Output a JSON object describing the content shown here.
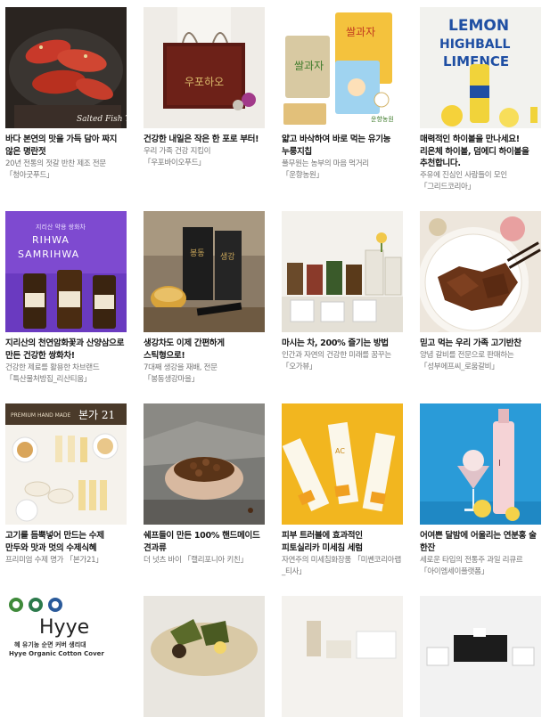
{
  "products": [
    {
      "title": "바다 본연의 맛을 가득 담아 짜지 않은 명란젓",
      "desc": "20년 전통의 젓갈 반찬 제조 전문 「청아굿푸드」",
      "thumb_text": "Salted Fish Types",
      "thumb_icon": "salted-roe-photo-icon"
    },
    {
      "title": "건강한 내일은 작은 한 포로 부터!",
      "desc": "우리 가족 건강 지킴이 「우포바이오푸드」",
      "thumb_text": "",
      "thumb_icon": "gift-box-photo-icon"
    },
    {
      "title": "얇고 바삭하여 바로 먹는 유기농 누룽지칩",
      "desc": "풀무원는 농부의 마음 먹거리 「운향농원」",
      "thumb_text": "",
      "thumb_icon": "nurungji-snack-photo-icon"
    },
    {
      "title": "매력적인 하이볼을 만나세요! 리온체 하이볼, 덤에디 하이볼을 추천합니다.",
      "desc": "주유에 진심인 사람들이 모인 「그리드코리아」",
      "thumb_text": "LEMON HIGHBALL LIMENCE",
      "thumb_icon": "highball-can-photo-icon"
    },
    {
      "title": "지리산의 천연암화꽃과 산양삼으로 만든 건강한 쌍화차!",
      "desc": "건강한 제료를 활용한 차브랜드 「특산물처방집_리산티움」",
      "thumb_text": "RIHWA SAMRIHWA",
      "thumb_icon": "herbal-tea-bottle-photo-icon"
    },
    {
      "title": "생강차도 이제 간편하게 스틱형으로!",
      "desc": "7대째 생강을 재배, 전문 「봉동생강마을」",
      "thumb_text": "",
      "thumb_icon": "ginger-tea-box-photo-icon"
    },
    {
      "title": "마시는 차, 200% 즐기는 방법",
      "desc": "인간과 자연의 건강한 미래를 꿈꾸는 「오가뷰」",
      "thumb_text": "",
      "thumb_icon": "tea-set-photo-icon"
    },
    {
      "title": "믿고 먹는 우리 가족 고기반찬",
      "desc": "양념 갈비를 전문으로 판매하는 「성부에프씨_로움갈비」",
      "thumb_text": "",
      "thumb_icon": "braised-meat-photo-icon"
    },
    {
      "title": "고기를 듬뿍넣어 만드는 수제 만두와 맛과 멋의 수제식혜",
      "desc": "프리미엄 수제 명가 「본가21」",
      "thumb_text": "본가 21",
      "thumb_icon": "dumpling-sikhye-photo-icon"
    },
    {
      "title": "쉐프들이 만든 100% 핸드메이드 견과류",
      "desc": "더 넛츠 바이 「캘리포니아 키친」",
      "thumb_text": "",
      "thumb_icon": "nuts-hand-photo-icon"
    },
    {
      "title": "피부 트러블에 효과적인 피토실리카 미세침 세럼",
      "desc": "자연주의 미세침화장품 「미쏀코리아랩_티사」",
      "thumb_text": "",
      "thumb_icon": "serum-tube-photo-icon"
    },
    {
      "title": "어여쁜 달밤에 어울리는 연분홍 술 한잔",
      "desc": "세로운 타입의 전통주 과일 리큐르 「아이엠세이플랫폼」",
      "thumb_text": "",
      "thumb_icon": "pink-liquor-photo-icon"
    },
    {
      "title": "",
      "desc": "",
      "thumb_text": "Hyye",
      "thumb_sub1": "혜 유기농 순면 커버 생리대",
      "thumb_sub2": "Hyye Organic Cotton Cover",
      "thumb_icon": "organic-pad-photo-icon"
    },
    {
      "title": "",
      "desc": "",
      "thumb_text": "",
      "thumb_icon": "rice-cake-photo-icon"
    },
    {
      "title": "",
      "desc": "",
      "thumb_text": "",
      "thumb_icon": "gift-set-photo-icon"
    },
    {
      "title": "",
      "desc": "",
      "thumb_text": "",
      "thumb_icon": "black-gift-box-photo-icon"
    }
  ],
  "colors": {
    "title": "#1a1a1a",
    "desc": "#777777",
    "background": "#ffffff"
  }
}
